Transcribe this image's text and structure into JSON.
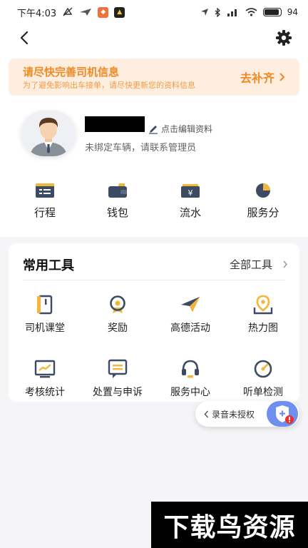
{
  "status_bar": {
    "time": "下午4:03",
    "battery": "94"
  },
  "banner": {
    "title": "请尽快完善司机信息",
    "subtitle": "为了避免影响出车接单，请尽快更新您的资料信息",
    "cta": "去补齐"
  },
  "profile": {
    "edit_label": "点击编辑资料",
    "vehicle_status": "未绑定车辆，请联系管理员"
  },
  "quick_actions": [
    {
      "label": "行程",
      "icon": "trip-icon"
    },
    {
      "label": "钱包",
      "icon": "wallet-icon"
    },
    {
      "label": "流水",
      "icon": "ledger-icon"
    },
    {
      "label": "服务分",
      "icon": "pie-chart-icon"
    }
  ],
  "tools": {
    "title": "常用工具",
    "all_label": "全部工具",
    "items": [
      {
        "label": "司机课堂",
        "icon": "book-icon"
      },
      {
        "label": "奖励",
        "icon": "medal-icon"
      },
      {
        "label": "高德活动",
        "icon": "paper-plane-icon"
      },
      {
        "label": "热力图",
        "icon": "location-pin-icon"
      },
      {
        "label": "考核统计",
        "icon": "stats-chart-icon"
      },
      {
        "label": "处置与申诉",
        "icon": "message-list-icon"
      },
      {
        "label": "服务中心",
        "icon": "headset-icon"
      },
      {
        "label": "听单检测",
        "icon": "gauge-icon"
      }
    ]
  },
  "recording": {
    "label": "录音未授权"
  },
  "watermark": {
    "text": "下载鸟资源"
  },
  "colors": {
    "accent_orange": "#f08a24",
    "banner_bg": "#fdeee0",
    "icon_dark": "#3c4a63",
    "icon_gold": "#f3b53a"
  }
}
